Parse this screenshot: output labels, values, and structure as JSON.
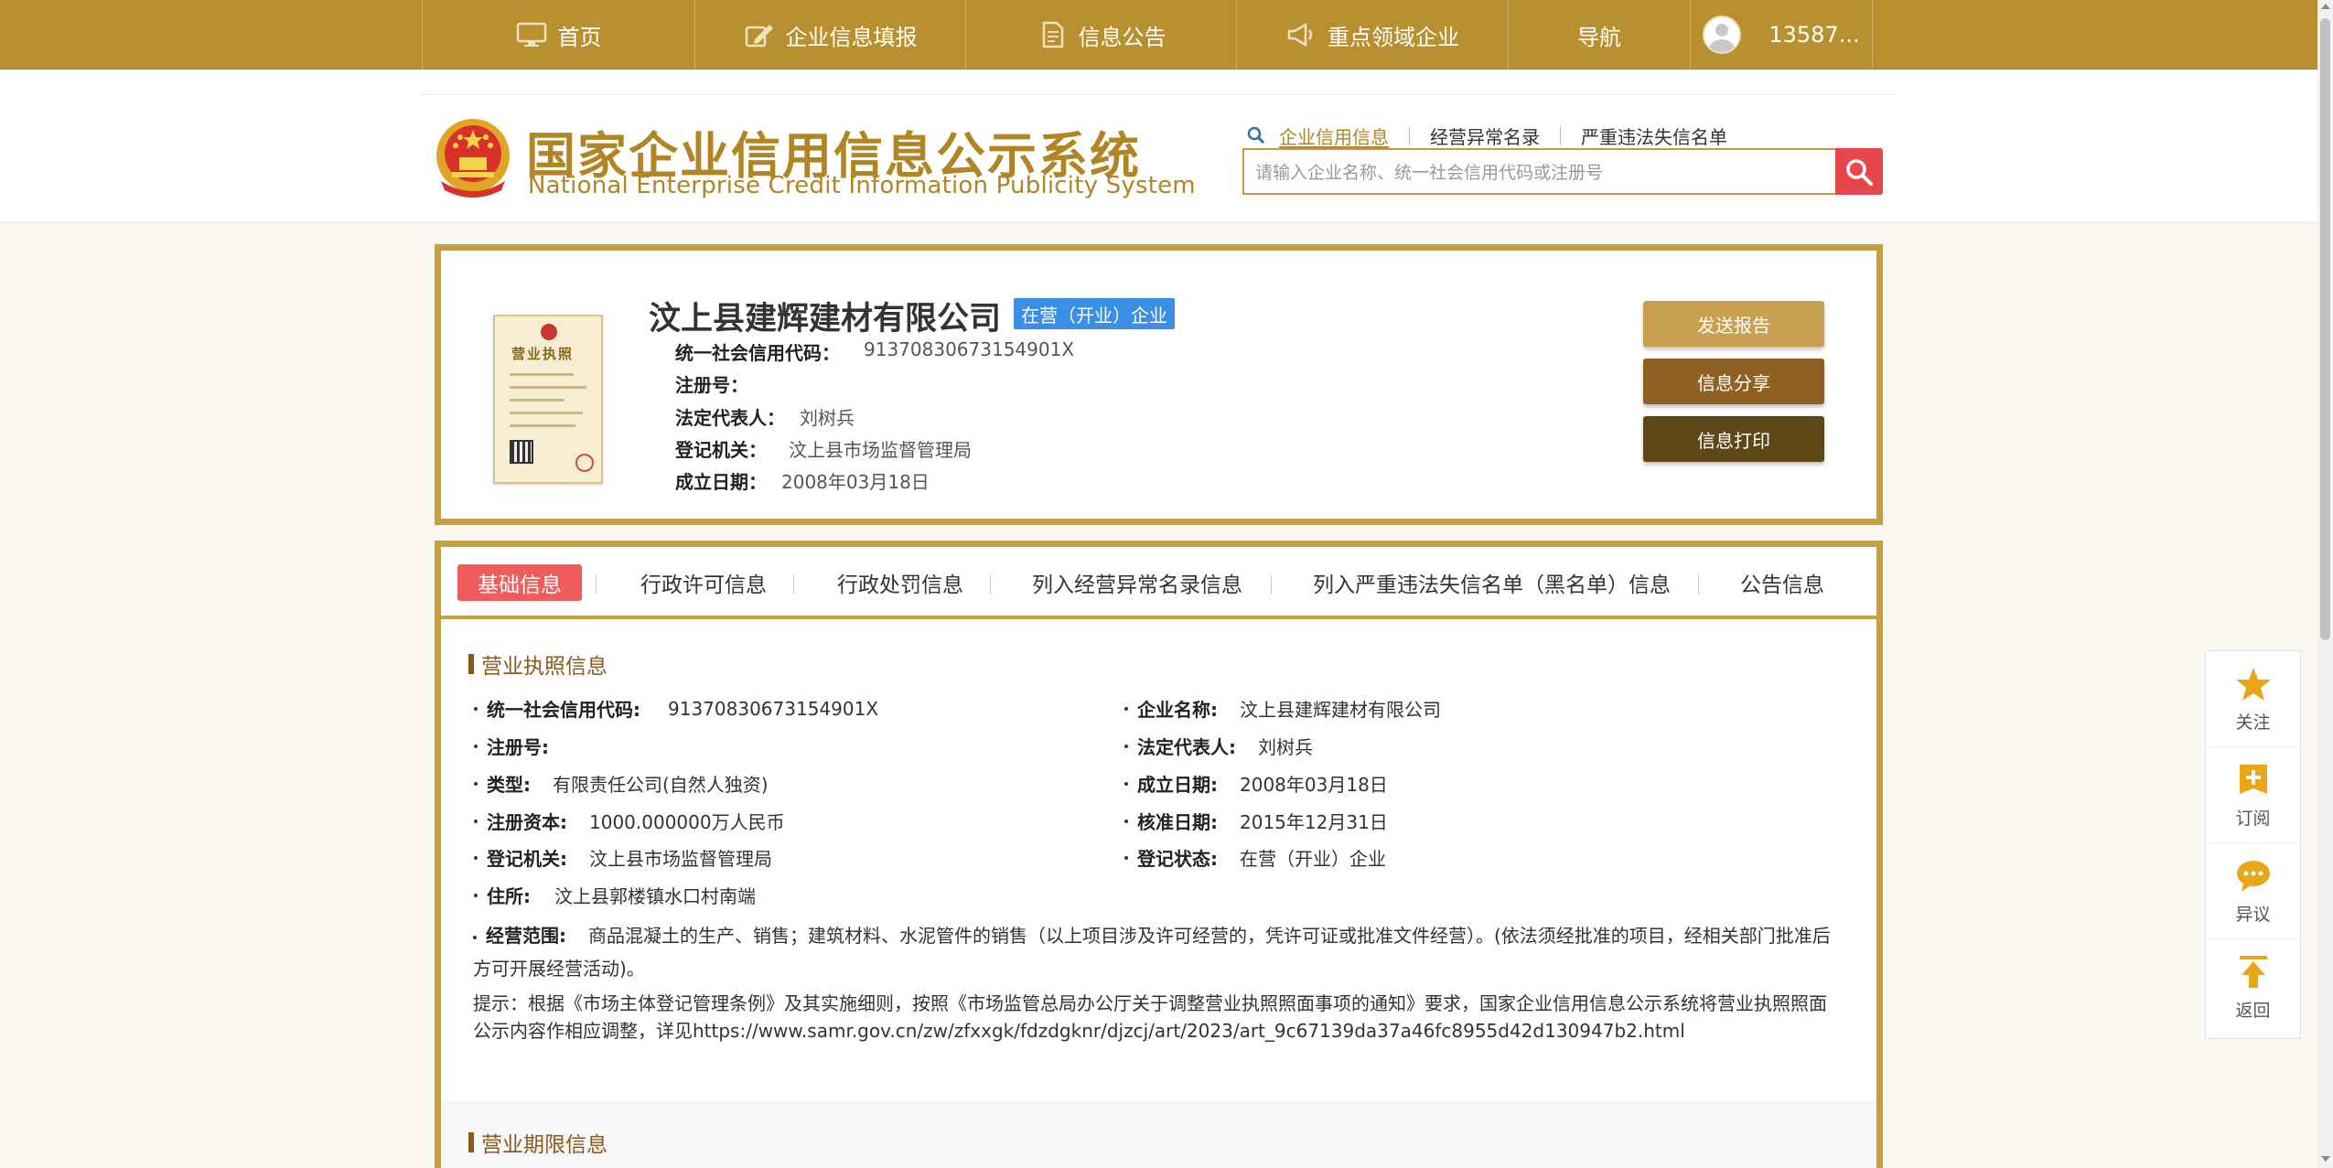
{
  "colors": {
    "nav_bg": "#b8902f",
    "brand_gold": "#b28524",
    "card_border": "#c9a035",
    "active_tab": "#f05c5c",
    "status_badge": "#3a8ee6",
    "btn_send": "#c9a050",
    "btn_share": "#8f6224",
    "btn_print": "#5f4818",
    "search_btn": "#e8464d"
  },
  "nav": {
    "items": [
      {
        "label": "首页",
        "icon": "monitor-icon"
      },
      {
        "label": "企业信息填报",
        "icon": "edit-icon"
      },
      {
        "label": "信息公告",
        "icon": "document-icon"
      },
      {
        "label": "重点领域企业",
        "icon": "megaphone-icon"
      },
      {
        "label": "导航",
        "icon": ""
      }
    ],
    "user": "13587..."
  },
  "header": {
    "logo_cn": "国家企业信用信息公示系统",
    "logo_en": "National Enterprise Credit Information Publicity System",
    "search_tabs": [
      "企业信用信息",
      "经营异常名录",
      "严重违法失信名单"
    ],
    "search_placeholder": "请输入企业名称、统一社会信用代码或注册号"
  },
  "company": {
    "name": "汶上县建辉建材有限公司",
    "status": "在营（开业）企业",
    "license_title": "营业执照",
    "fields": [
      {
        "k": "统一社会信用代码：",
        "v": "91370830673154901X"
      },
      {
        "k": "注册号：",
        "v": ""
      },
      {
        "k": "法定代表人：",
        "v": "刘树兵"
      },
      {
        "k": "登记机关：",
        "v": "汶上县市场监督管理局"
      },
      {
        "k": "成立日期：",
        "v": "2008年03月18日"
      }
    ],
    "buttons": {
      "send": "发送报告",
      "share": "信息分享",
      "print": "信息打印"
    }
  },
  "tabs": [
    "基础信息",
    "行政许可信息",
    "行政处罚信息",
    "列入经营异常名录信息",
    "列入严重违法失信名单（黑名单）信息",
    "公告信息"
  ],
  "license_info": {
    "title": "营业执照信息",
    "left": [
      {
        "k": "统一社会信用代码:",
        "v": "91370830673154901X"
      },
      {
        "k": "注册号:",
        "v": ""
      },
      {
        "k": "类型:",
        "v": "有限责任公司(自然人独资)"
      },
      {
        "k": "注册资本:",
        "v": "1000.000000万人民币"
      },
      {
        "k": "登记机关:",
        "v": "汶上县市场监督管理局"
      },
      {
        "k": "住所:",
        "v": "汶上县郭楼镇水口村南端"
      }
    ],
    "right": [
      {
        "k": "企业名称:",
        "v": "汶上县建辉建材有限公司"
      },
      {
        "k": "法定代表人:",
        "v": "刘树兵"
      },
      {
        "k": "成立日期:",
        "v": "2008年03月18日"
      },
      {
        "k": "核准日期:",
        "v": "2015年12月31日"
      },
      {
        "k": "登记状态:",
        "v": "在营（开业）企业"
      }
    ],
    "scope_label": "经营范围:",
    "scope_value": "商品混凝土的生产、销售；建筑材料、水泥管件的销售（以上项目涉及许可经营的，凭许可证或批准文件经营）。(依法须经批准的项目，经相关部门批准后方可开展经营活动)。",
    "notice": "提示：根据《市场主体登记管理条例》及其实施细则，按照《市场监管总局办公厅关于调整营业执照照面事项的通知》要求，国家企业信用信息公示系统将营业执照照面公示内容作相应调整，详见https://www.samr.gov.cn/zw/zfxxgk/fdzdgknr/djzcj/art/2023/art_9c67139da37a46fc8955d42d130947b2.html"
  },
  "term_info": {
    "title": "营业期限信息"
  },
  "side_toolbar": [
    {
      "label": "关注",
      "icon": "star-icon"
    },
    {
      "label": "订阅",
      "icon": "subscribe-icon"
    },
    {
      "label": "异议",
      "icon": "comment-icon"
    },
    {
      "label": "返回",
      "icon": "back-to-top-icon"
    }
  ]
}
